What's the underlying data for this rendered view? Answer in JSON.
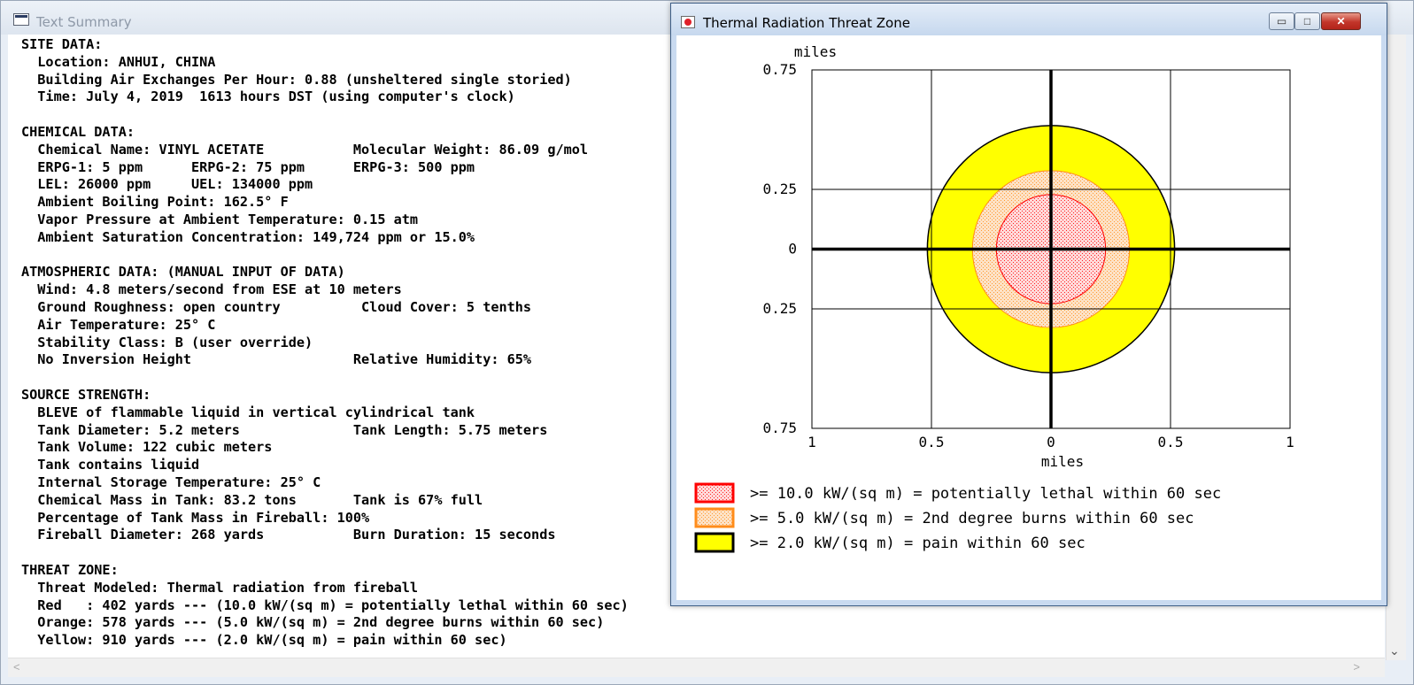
{
  "text_summary": {
    "title": "Text Summary",
    "lines": [
      "SITE DATA:",
      "  Location: ANHUI, CHINA",
      "  Building Air Exchanges Per Hour: 0.88 (unsheltered single storied)",
      "  Time: July 4, 2019  1613 hours DST (using computer's clock)",
      "",
      "CHEMICAL DATA:",
      "  Chemical Name: VINYL ACETATE           Molecular Weight: 86.09 g/mol",
      "  ERPG-1: 5 ppm      ERPG-2: 75 ppm      ERPG-3: 500 ppm",
      "  LEL: 26000 ppm     UEL: 134000 ppm",
      "  Ambient Boiling Point: 162.5° F",
      "  Vapor Pressure at Ambient Temperature: 0.15 atm",
      "  Ambient Saturation Concentration: 149,724 ppm or 15.0%",
      "",
      "ATMOSPHERIC DATA: (MANUAL INPUT OF DATA)",
      "  Wind: 4.8 meters/second from ESE at 10 meters",
      "  Ground Roughness: open country          Cloud Cover: 5 tenths",
      "  Air Temperature: 25° C",
      "  Stability Class: B (user override)",
      "  No Inversion Height                    Relative Humidity: 65%",
      "",
      "SOURCE STRENGTH:",
      "  BLEVE of flammable liquid in vertical cylindrical tank",
      "  Tank Diameter: 5.2 meters              Tank Length: 5.75 meters",
      "  Tank Volume: 122 cubic meters",
      "  Tank contains liquid",
      "  Internal Storage Temperature: 25° C",
      "  Chemical Mass in Tank: 83.2 tons       Tank is 67% full",
      "  Percentage of Tank Mass in Fireball: 100%",
      "  Fireball Diameter: 268 yards           Burn Duration: 15 seconds",
      "",
      "THREAT ZONE:",
      "  Threat Modeled: Thermal radiation from fireball",
      "  Red   : 402 yards --- (10.0 kW/(sq m) = potentially lethal within 60 sec)",
      "  Orange: 578 yards --- (5.0 kW/(sq m) = 2nd degree burns within 60 sec)",
      "  Yellow: 910 yards --- (2.0 kW/(sq m) = pain within 60 sec)"
    ]
  },
  "threat_window": {
    "title": "Thermal Radiation Threat Zone",
    "controls": {
      "minimize": "▭",
      "maximize": "□",
      "close": "✕"
    }
  },
  "chart_data": {
    "type": "threat-zone",
    "xlabel": "miles",
    "ylabel": "miles",
    "xlim": [
      -1,
      1
    ],
    "ylim": [
      -0.75,
      0.75
    ],
    "x_ticks": [
      {
        "v": -1,
        "label": "1"
      },
      {
        "v": -0.5,
        "label": "0.5"
      },
      {
        "v": 0,
        "label": "0"
      },
      {
        "v": 0.5,
        "label": "0.5"
      },
      {
        "v": 1,
        "label": "1"
      }
    ],
    "y_ticks": [
      {
        "v": 0.75,
        "label": "0.75"
      },
      {
        "v": 0.25,
        "label": "0.25"
      },
      {
        "v": 0,
        "label": "0"
      },
      {
        "v": -0.25,
        "label": "0.25"
      },
      {
        "v": -0.75,
        "label": "0.75"
      }
    ],
    "grid": true,
    "zones": [
      {
        "name": "yellow",
        "radius_yards": 910,
        "fill": "#ffff00",
        "stroke": "#000000",
        "pattern": false
      },
      {
        "name": "orange",
        "radius_yards": 578,
        "fill": "#fbd9b6",
        "stroke": "#ff8c1a",
        "pattern": true
      },
      {
        "name": "red",
        "radius_yards": 402,
        "fill": "#ffd6d6",
        "stroke": "#ff0000",
        "pattern": true
      }
    ],
    "legend": [
      {
        "label": ">= 10.0 kW/(sq m) = potentially lethal within 60 sec",
        "fill": "#ffd6d6",
        "stroke": "#ff0000",
        "pattern": true
      },
      {
        "label": ">= 5.0 kW/(sq m) = 2nd degree burns within 60 sec",
        "fill": "#fbd9b6",
        "stroke": "#ff8c1a",
        "pattern": true
      },
      {
        "label": ">= 2.0 kW/(sq m) = pain within 60 sec",
        "fill": "#ffff00",
        "stroke": "#000000",
        "pattern": false
      }
    ]
  }
}
